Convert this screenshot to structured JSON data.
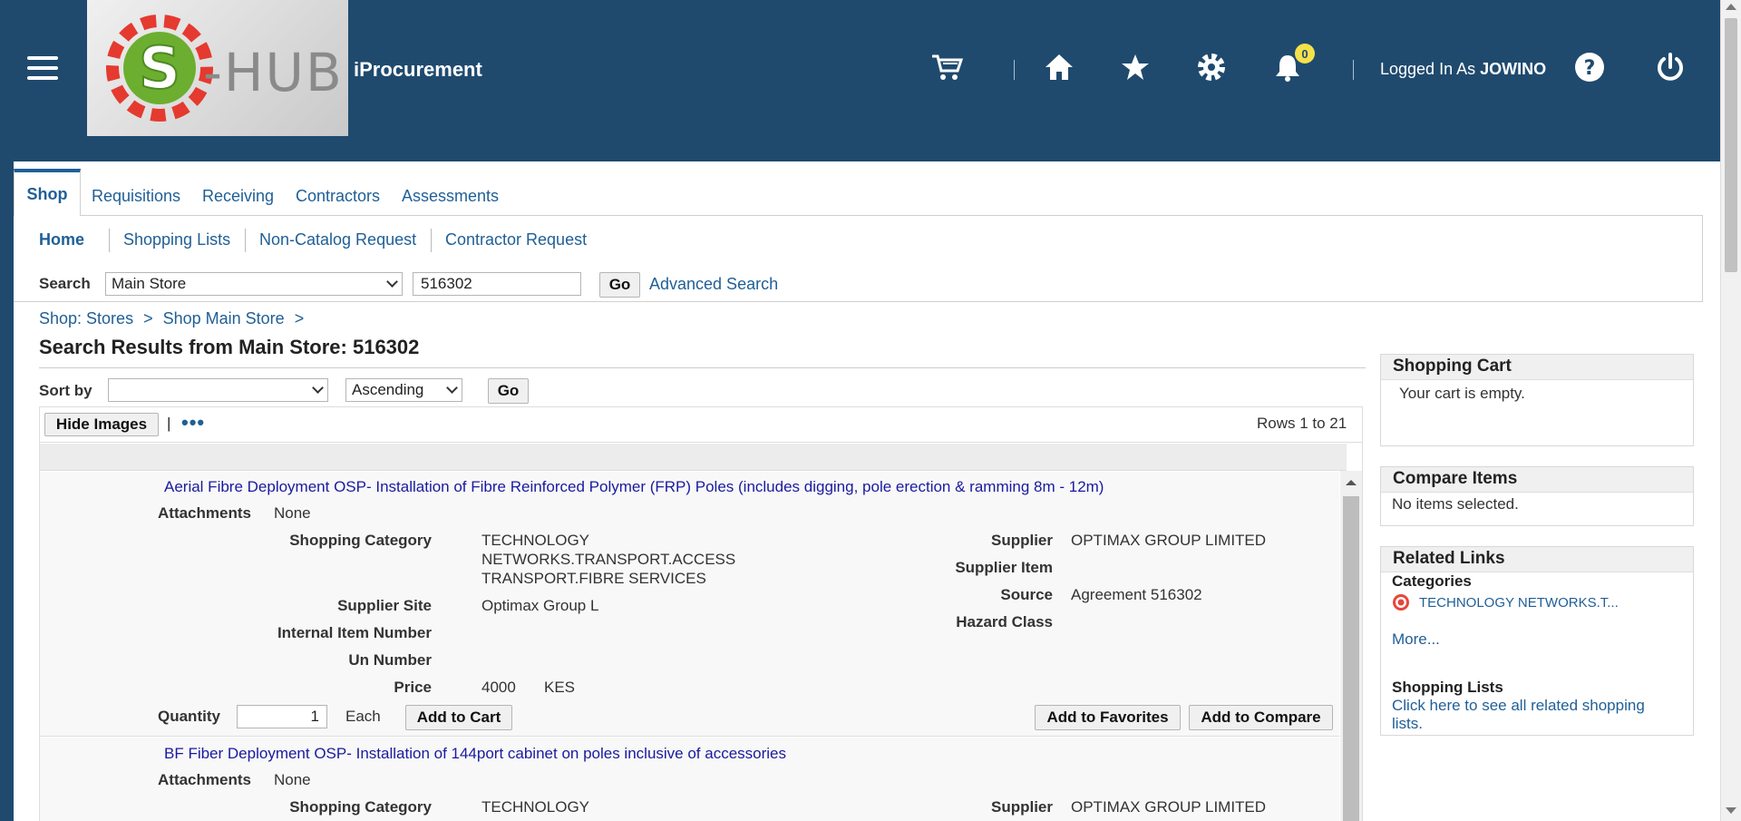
{
  "header": {
    "app_name": "iProcurement",
    "logo_text": "S-HUB",
    "notification_count": "0",
    "logged_in_prefix": "Logged In As",
    "username": "JOWINO",
    "icons": [
      "menu-icon",
      "cart-icon",
      "home-icon",
      "star-icon",
      "gear-icon",
      "bell-icon",
      "help-icon",
      "power-icon"
    ]
  },
  "tabs": [
    "Shop",
    "Requisitions",
    "Receiving",
    "Contractors",
    "Assessments"
  ],
  "subnav": [
    "Home",
    "Shopping Lists",
    "Non-Catalog Request",
    "Contractor Request"
  ],
  "search": {
    "label": "Search",
    "store": "Main Store",
    "query": "516302",
    "go": "Go",
    "advanced": "Advanced Search"
  },
  "breadcrumb": [
    "Shop: Stores",
    ">",
    "Shop Main Store",
    ">"
  ],
  "results": {
    "title": "Search Results from Main Store: 516302",
    "sort_label": "Sort by",
    "sort_value": "",
    "order_value": "Ascending",
    "go": "Go",
    "hide_images": "Hide Images",
    "pipe": "|",
    "rows": "Rows 1 to 21"
  },
  "item1": {
    "title": "Aerial Fibre Deployment OSP- Installation of Fibre Reinforced Polymer (FRP) Poles (includes digging, pole erection & ramming 8m - 12m)",
    "attachments_label": "Attachments",
    "attachments": "None",
    "category_label": "Shopping Category",
    "category_1": "TECHNOLOGY",
    "category_2": "NETWORKS.TRANSPORT.ACCESS",
    "category_3": "TRANSPORT.FIBRE SERVICES",
    "site_label": "Supplier Site",
    "site": "Optimax Group L",
    "internal_label": "Internal Item Number",
    "un_label": "Un Number",
    "price_label": "Price",
    "price": "4000",
    "currency": "KES",
    "supplier_label": "Supplier",
    "supplier": "OPTIMAX GROUP LIMITED",
    "supplier_item_label": "Supplier Item",
    "source_label": "Source",
    "source": "Agreement 516302",
    "hazard_label": "Hazard Class",
    "quantity_label": "Quantity",
    "quantity": "1",
    "uom": "Each",
    "add_cart": "Add to Cart",
    "add_fav": "Add to Favorites",
    "add_compare": "Add to Compare"
  },
  "item2": {
    "title": "BF Fiber Deployment OSP- Installation of 144port cabinet on poles inclusive of accessories",
    "attachments_label": "Attachments",
    "attachments": "None",
    "category_label": "Shopping Category",
    "category_1": "TECHNOLOGY",
    "supplier_label": "Supplier",
    "supplier": "OPTIMAX GROUP LIMITED"
  },
  "side": {
    "cart_title": "Shopping Cart",
    "cart_empty": "Your cart is empty.",
    "compare_title": "Compare Items",
    "compare_empty": "No items selected.",
    "links_title": "Related Links",
    "categories_label": "Categories",
    "category_link": "TECHNOLOGY NETWORKS.T...",
    "more": "More...",
    "lists_label": "Shopping Lists",
    "lists_link_1": "Click here to see all related shopping",
    "lists_link_2": "lists."
  }
}
